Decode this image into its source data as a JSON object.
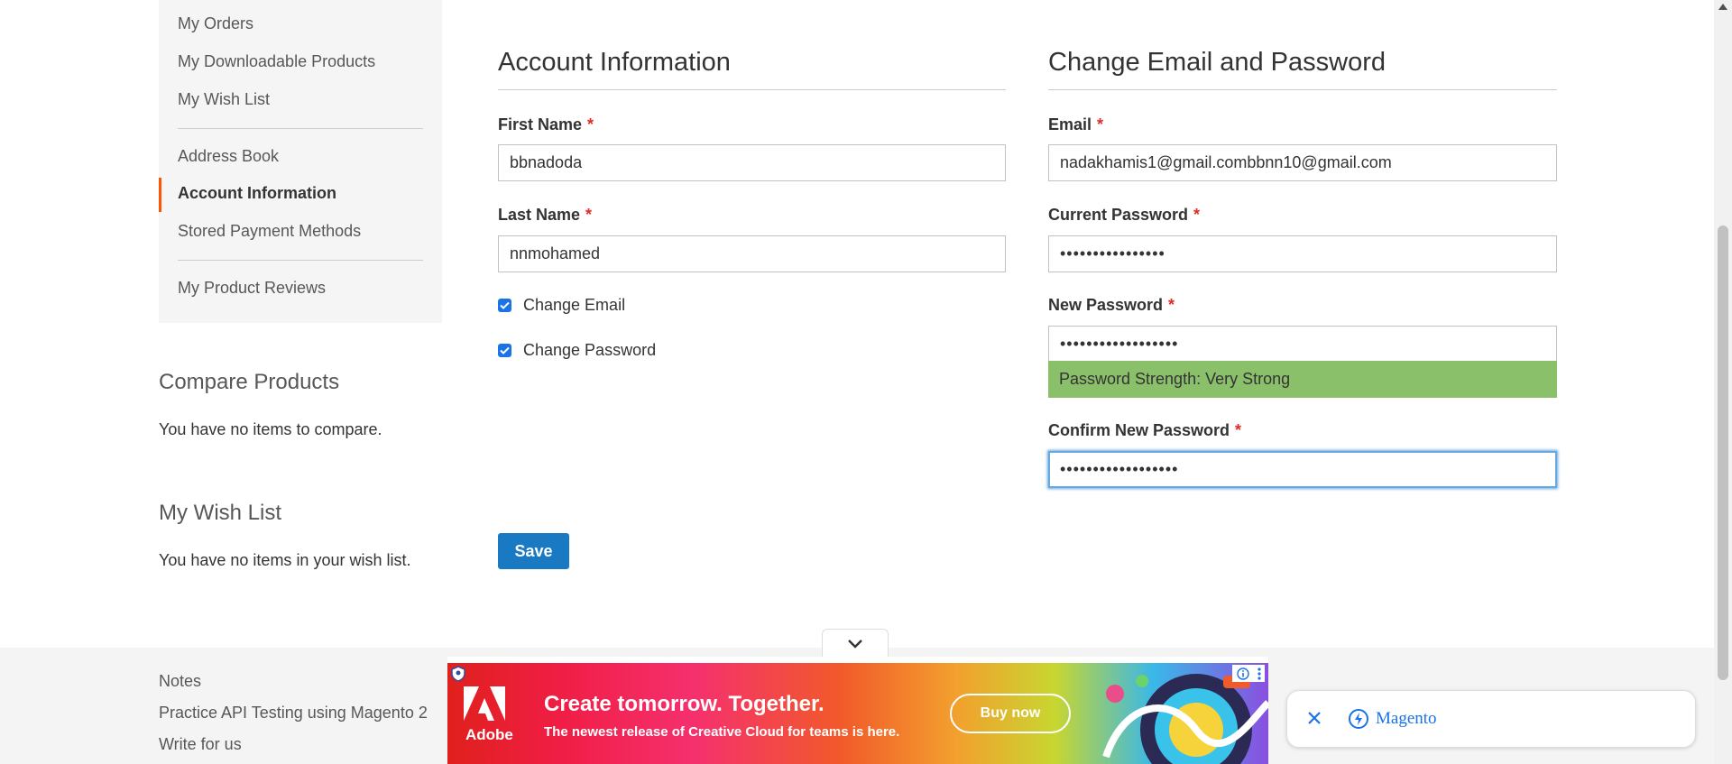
{
  "sidebar": {
    "items": [
      {
        "label": "My Orders"
      },
      {
        "label": "My Downloadable Products"
      },
      {
        "label": "My Wish List"
      },
      {
        "label": "Address Book"
      },
      {
        "label": "Account Information",
        "active": true
      },
      {
        "label": "Stored Payment Methods"
      },
      {
        "label": "My Product Reviews"
      }
    ],
    "accent_color": "#ff5501"
  },
  "compare": {
    "title": "Compare Products",
    "empty_text": "You have no items to compare."
  },
  "wishlist": {
    "title": "My Wish List",
    "empty_text": "You have no items in your wish list."
  },
  "account_info": {
    "title": "Account Information",
    "first_name_label": "First Name",
    "first_name_value": "bbnadoda",
    "last_name_label": "Last Name",
    "last_name_value": "nnmohamed",
    "change_email_label": "Change Email",
    "change_email_checked": true,
    "change_password_label": "Change Password",
    "change_password_checked": true
  },
  "change_email_password": {
    "title": "Change Email and Password",
    "email_label": "Email",
    "email_value": "nadakhamis1@gmail.combbnn10@gmail.com",
    "current_password_label": "Current Password",
    "current_password_mask": "••••••••••••••••",
    "new_password_label": "New Password",
    "new_password_mask": "••••••••••••••••••",
    "strength_text": "Password Strength: Very Strong",
    "strength_color": "#8bc06b",
    "confirm_password_label": "Confirm New Password",
    "confirm_password_mask": "••••••••••••••••••"
  },
  "required_marker": "*",
  "save_label": "Save",
  "footer": {
    "links": [
      "Notes",
      "Practice API Testing using Magento 2",
      "Write for us"
    ]
  },
  "ad": {
    "brand": "Adobe",
    "headline": "Create tomorrow. Together.",
    "subline": "The newest release of Creative Cloud for teams is here.",
    "cta": "Buy now"
  },
  "chip": {
    "label": "Magento"
  }
}
